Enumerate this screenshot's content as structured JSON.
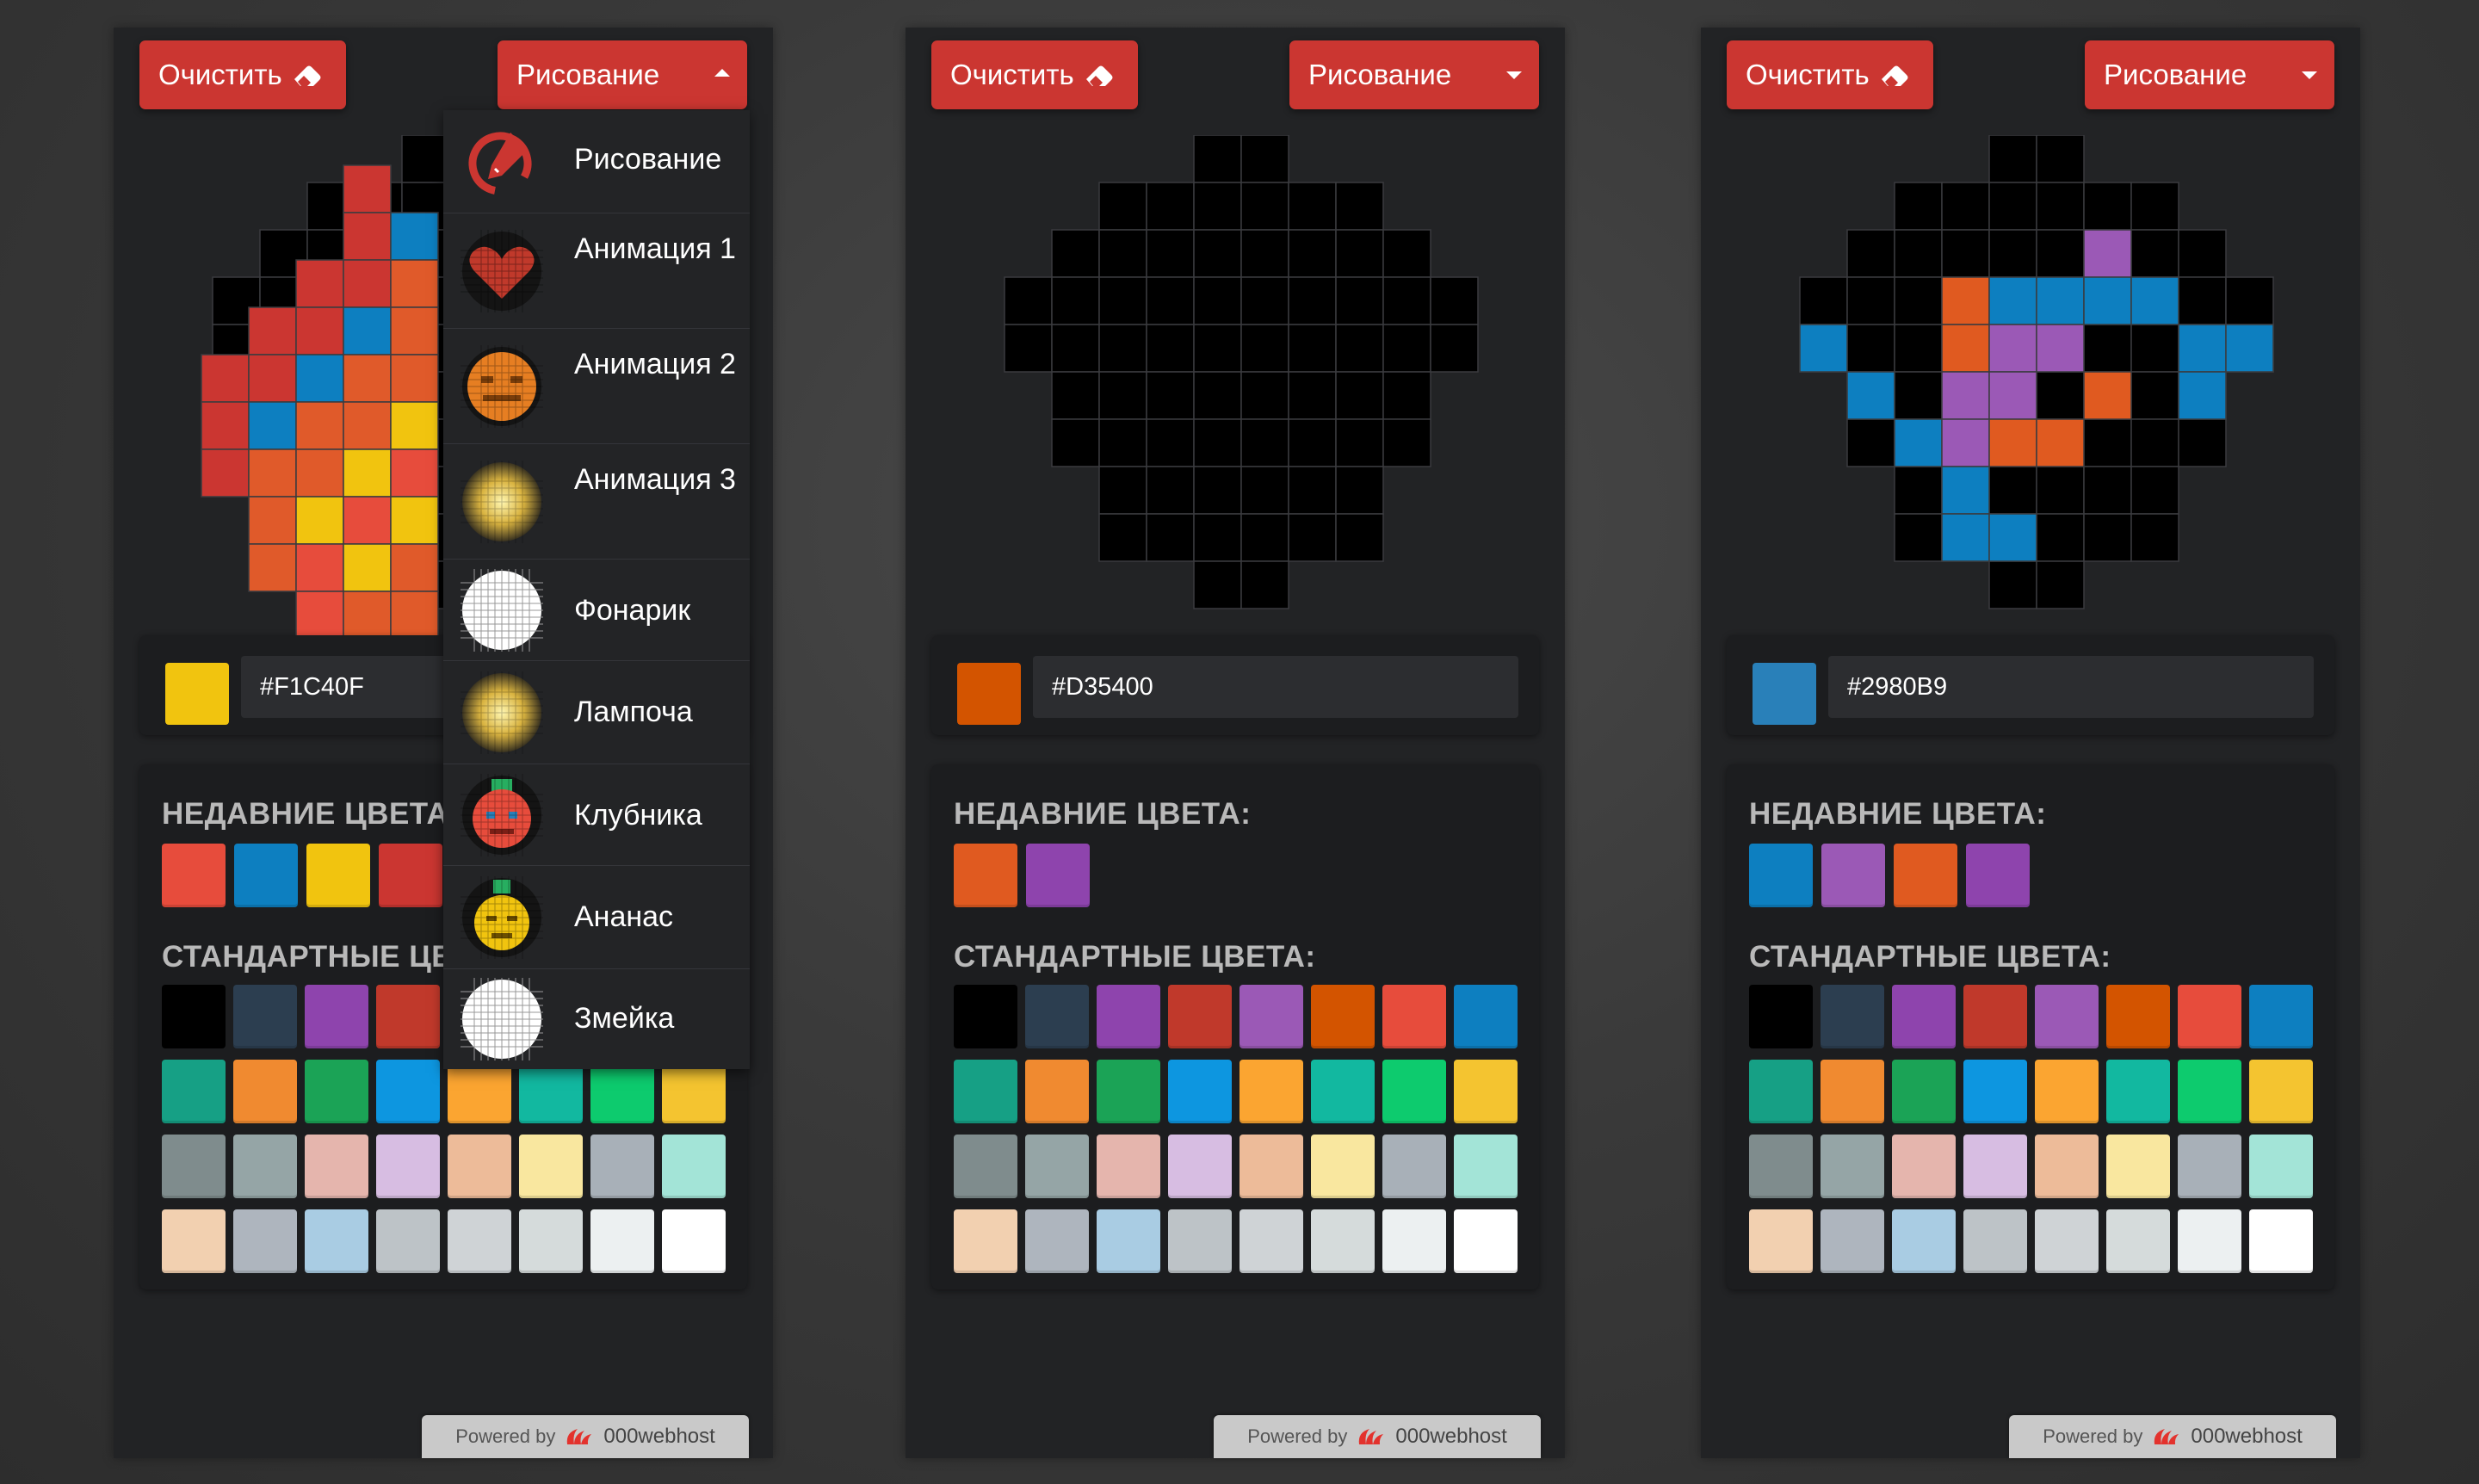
{
  "panels": [
    {
      "clear_label": "Очистить",
      "mode_label": "Рисование",
      "dropdown_open": true,
      "current_color": "#F1C40F",
      "recent_colors": [
        "#E74C3C",
        "#0D7FC0",
        "#F1C40F",
        "#CB3631"
      ],
      "grid_cells": [
        [
          1,
          2,
          "#CB3631"
        ],
        [
          2,
          2,
          "#CB3631"
        ],
        [
          2,
          3,
          "#0D7FC0"
        ],
        [
          3,
          1,
          "#CB3631"
        ],
        [
          3,
          2,
          "#CB3631"
        ],
        [
          3,
          3,
          "#E05A2A"
        ],
        [
          4,
          0,
          "#CB3631"
        ],
        [
          4,
          1,
          "#CB3631"
        ],
        [
          4,
          2,
          "#0D7FC0"
        ],
        [
          4,
          3,
          "#E05A2A"
        ],
        [
          5,
          -1,
          "#CB3631"
        ],
        [
          5,
          0,
          "#CB3631"
        ],
        [
          5,
          1,
          "#0D7FC0"
        ],
        [
          5,
          2,
          "#E05A2A"
        ],
        [
          5,
          3,
          "#E05A2A"
        ],
        [
          6,
          -1,
          "#CB3631"
        ],
        [
          6,
          0,
          "#0D7FC0"
        ],
        [
          6,
          1,
          "#E05A2A"
        ],
        [
          6,
          2,
          "#E05A2A"
        ],
        [
          6,
          3,
          "#F1C40F"
        ],
        [
          7,
          -1,
          "#CB3631"
        ],
        [
          7,
          0,
          "#E05A2A"
        ],
        [
          7,
          1,
          "#E05A2A"
        ],
        [
          7,
          2,
          "#F1C40F"
        ],
        [
          7,
          3,
          "#E74C3C"
        ],
        [
          8,
          0,
          "#E05A2A"
        ],
        [
          8,
          1,
          "#F1C40F"
        ],
        [
          8,
          2,
          "#E74C3C"
        ],
        [
          8,
          3,
          "#F1C40F"
        ],
        [
          9,
          0,
          "#E05A2A"
        ],
        [
          9,
          1,
          "#E74C3C"
        ],
        [
          9,
          2,
          "#F1C40F"
        ],
        [
          9,
          3,
          "#E05A2A"
        ],
        [
          10,
          1,
          "#E74C3C"
        ],
        [
          10,
          2,
          "#E05A2A"
        ],
        [
          10,
          3,
          "#E05A2A"
        ],
        [
          11,
          3,
          "#CB3631"
        ]
      ]
    },
    {
      "clear_label": "Очистить",
      "mode_label": "Рисование",
      "dropdown_open": false,
      "current_color": "#D35400",
      "recent_colors": [
        "#E05A20",
        "#8E44AD"
      ],
      "grid_cells": []
    },
    {
      "clear_label": "Очистить",
      "mode_label": "Рисование",
      "dropdown_open": false,
      "current_color": "#2980B9",
      "recent_colors": [
        "#0D7FC0",
        "#9B59B6",
        "#E05A20",
        "#8E44AD"
      ],
      "grid_cells": [
        [
          2,
          6,
          "#9B59B6"
        ],
        [
          3,
          3,
          "#E05A20"
        ],
        [
          3,
          4,
          "#0D7FC0"
        ],
        [
          3,
          5,
          "#0D7FC0"
        ],
        [
          3,
          6,
          "#0D7FC0"
        ],
        [
          3,
          7,
          "#0D7FC0"
        ],
        [
          4,
          0,
          "#0D7FC0"
        ],
        [
          4,
          3,
          "#E05A20"
        ],
        [
          4,
          4,
          "#9B59B6"
        ],
        [
          4,
          5,
          "#9B59B6"
        ],
        [
          4,
          8,
          "#0D7FC0"
        ],
        [
          4,
          9,
          "#0D7FC0"
        ],
        [
          5,
          1,
          "#0D7FC0"
        ],
        [
          5,
          3,
          "#9B59B6"
        ],
        [
          5,
          4,
          "#9B59B6"
        ],
        [
          5,
          6,
          "#E05A20"
        ],
        [
          5,
          8,
          "#0D7FC0"
        ],
        [
          6,
          2,
          "#0D7FC0"
        ],
        [
          6,
          3,
          "#9B59B6"
        ],
        [
          6,
          4,
          "#E05A20"
        ],
        [
          6,
          5,
          "#E05A20"
        ],
        [
          7,
          3,
          "#0D7FC0"
        ],
        [
          8,
          3,
          "#0D7FC0"
        ],
        [
          8,
          4,
          "#0D7FC0"
        ]
      ]
    }
  ],
  "grid_rows": [
    [
      4,
      5
    ],
    [
      2,
      7
    ],
    [
      1,
      8
    ],
    [
      0,
      9
    ],
    [
      0,
      9
    ],
    [
      1,
      8
    ],
    [
      1,
      8
    ],
    [
      2,
      7
    ],
    [
      2,
      7
    ],
    [
      4,
      5
    ]
  ],
  "recent_title": "НЕДАВНИЕ ЦВЕТА:",
  "standard_title": "СТАНДАРТНЫЕ ЦВЕТА:",
  "standard_colors": [
    "#000000",
    "#2C3E50",
    "#8E44AD",
    "#C0392B",
    "#9B59B6",
    "#D35400",
    "#E74C3C",
    "#0D7FC0",
    "#16A085",
    "#F08A30",
    "#1BA356",
    "#0D96E0",
    "#FBA531",
    "#12B8A0",
    "#0DCB6E",
    "#F4C430",
    "#7F8C8D",
    "#95A5A6",
    "#E5B5AD",
    "#D7BDE2",
    "#EDBB99",
    "#F9E79F",
    "#A8B0B8",
    "#A3E4D7",
    "#F2D0B0",
    "#AEB5BE",
    "#A9CCE3",
    "#BDC3C7",
    "#CFD3D6",
    "#D5DBDB",
    "#ECF0F1",
    "#FFFFFF"
  ],
  "dropdown_items": [
    {
      "label": "Рисование",
      "icon": "pencil-icon"
    },
    {
      "label": "Анимация 1",
      "icon": "heart-animation-icon"
    },
    {
      "label": "Анимация 2",
      "icon": "face-animation-icon"
    },
    {
      "label": "Анимация 3",
      "icon": "glow-animation-icon"
    },
    {
      "label": "Фонарик",
      "icon": "flashlight-icon"
    },
    {
      "label": "Лампоча",
      "icon": "lamp-icon"
    },
    {
      "label": "Клубника",
      "icon": "strawberry-icon"
    },
    {
      "label": "Ананас",
      "icon": "pineapple-icon"
    },
    {
      "label": "Змейка",
      "icon": "snake-icon"
    }
  ],
  "footer": {
    "powered_label": "Powered by",
    "brand": "000webhost"
  }
}
